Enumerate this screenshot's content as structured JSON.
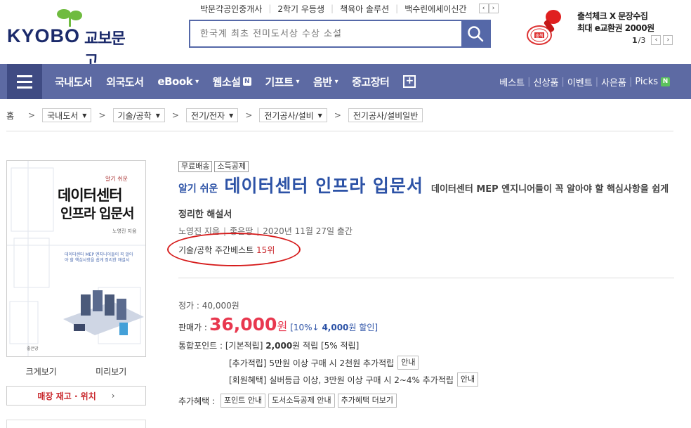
{
  "logo": {
    "brand": "KYOBO",
    "kor": "교보문고"
  },
  "toplinks": [
    "박문각공인중개사",
    "2학기 우등생",
    "책육아 솔루션",
    "백수린에세이신간"
  ],
  "search": {
    "placeholder": "한국계 최초 전미도서상 수상 소설"
  },
  "promo": {
    "stamp_text": "출첵",
    "line1": "출석체크 X 문장수집",
    "line2": "최대 e교환권 2000원",
    "page_current": "1",
    "page_total": "/3"
  },
  "nav": {
    "items": [
      "국내도서",
      "외국도서",
      "eBook",
      "웹소설",
      "기프트",
      "음반",
      "중고장터"
    ],
    "new_badge": "N",
    "right": [
      "베스트",
      "신상품",
      "이벤트",
      "사은품",
      "Picks"
    ]
  },
  "breadcrumb": {
    "home": "홈",
    "levels": [
      "국내도서",
      "기술/공학",
      "전기/전자",
      "전기공사/설비",
      "전기공사/설비일반"
    ]
  },
  "cover": {
    "small": "알기 쉬운",
    "title1": "데이터센터",
    "title2": "인프라 입문서",
    "author": "노영진 지음",
    "desc": "데이터센터 MEP 엔지니어들이 꼭 알아야 할 핵심사항을 쉽게 정리한 해설서",
    "publisher": "좋은땅"
  },
  "cover_links": {
    "zoom": "크게보기",
    "preview": "미리보기"
  },
  "stock_button": "매장 재고 · 위치",
  "product": {
    "tags": [
      "무료배송",
      "소득공제"
    ],
    "pre_title": "알기 쉬운",
    "title": "데이터센터 인프라 입문서",
    "subtitle": "데이터센터 MEP 엔지니어들이 꼭 알아야 할 핵심사항을 쉽게 정리한 해설서",
    "author": "노영진 지음",
    "publisher": "좋은땅",
    "date": "2020년 11월 27일 출간",
    "rank_label": "기술/공학 주간베스트",
    "rank_num": "15위"
  },
  "price": {
    "list": "정가 : 40,000원",
    "sale_label": "판매가 :",
    "sale": "36,000",
    "won": "원",
    "disc_open": "[10%↓",
    "disc_amount": "4,000",
    "disc_close": "원 할인]"
  },
  "points": {
    "label": "통합포인트 : [기본적립]",
    "amount": "2,000",
    "suffix": "원 적립 [5% 적립]",
    "add_text": "[추가적립] 5만원 이상 구매 시 2천원 추가적립",
    "member_text": "[회원혜택] 실버등급 이상, 3만원 이상 구매 시 2~4% 추가적립",
    "info": "안내"
  },
  "extra": {
    "label": "추가혜택 :",
    "buttons": [
      "포인트 안내",
      "도서소득공제 안내",
      "추가혜택 더보기"
    ]
  },
  "colors": {
    "nav": "#5d6aa3",
    "title": "#2c52a6",
    "price": "#e8384f",
    "highlight_circle": "#d61c1c"
  }
}
